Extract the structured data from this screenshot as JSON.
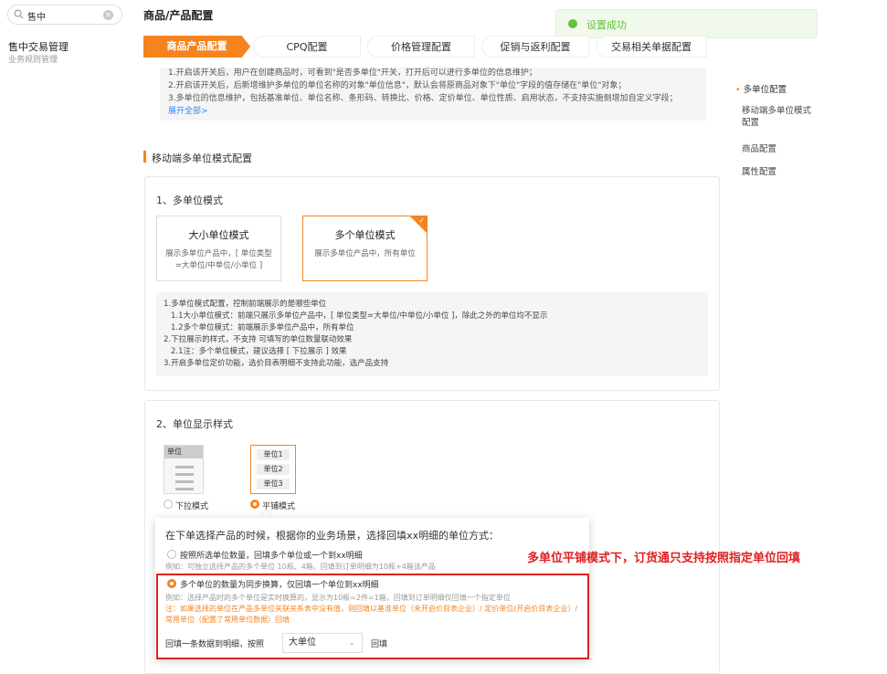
{
  "sidebar": {
    "search_value": "售中",
    "group_title": "售中交易管理",
    "group_sub": "业务规则管理"
  },
  "header": {
    "title": "商品/产品配置"
  },
  "toast": {
    "message": "设置成功",
    "color": "#67c23a"
  },
  "tabs": [
    "商品产品配置",
    "CPQ配置",
    "价格管理配置",
    "促销与返利配置",
    "交易相关单据配置"
  ],
  "info": {
    "lines": [
      "1.开启该开关后，用户在创建商品时，可看到\"是否多单位\"开关，打开后可以进行多单位的信息维护；",
      "2.开启该开关后，后新增维护多单位的单位名称的对象\"单位信息\"，默认会将原商品对象下\"单位\"字段的值存储在\"单位\"对象；",
      "3.多单位的信息维护，包括基准单位、单位名称、条形码、转换比、价格、定价单位、单位性质、启用状态，不支持实施侧增加自定义字段；"
    ],
    "expand_link": "展开全部>"
  },
  "anchors": [
    "多单位配置",
    "移动端多单位模式配置",
    "商品配置",
    "属性配置"
  ],
  "section": {
    "title": "移动端多单位模式配置"
  },
  "card1": {
    "heading": "1、多单位模式",
    "modes": [
      {
        "title": "大小单位模式",
        "desc": "展示多单位产品中，[ 单位类型=大单位/中单位/小单位 ]"
      },
      {
        "title": "多个单位模式",
        "desc": "展示多单位产品中，所有单位"
      }
    ],
    "notes": [
      "1.多单位模式配置，控制前端展示的是哪些单位",
      "1.1大小单位模式：前端只展示多单位产品中，[ 单位类型=大单位/中单位/小单位 ]，除此之外的单位均不显示",
      "1.2多个单位模式：前端展示多单位产品中，所有单位",
      "2.下拉展示的样式，不支持 可填写的单位数量联动效果",
      "2.1注：多个单位模式，建议选择 [ 下拉展示 ] 效果",
      "3.开启多单位定价功能，选价目表明细不支持此功能，选产品支持"
    ]
  },
  "card2": {
    "heading": "2、单位显示样式",
    "dropdown_icon_label": "单位",
    "tile_cells": [
      "单位1",
      "单位2",
      "单位3"
    ],
    "style_options": [
      "下拉模式",
      "平铺模式"
    ]
  },
  "popover": {
    "question": "在下单选择产品的时候，根据你的业务场景，选择回填xx明细的单位方式：",
    "option1": "按照所选单位数量，回填多个单位或一个到xx明细",
    "option1_example": "例如：可独立选择产品的多个单位 10瓶、4箱，回填到订单明细为10瓶+4箱该产品",
    "option2": "多个单位的数量为同步换算，仅回填一个单位到xx明细",
    "option2_example": "例如：选择产品时的多个单位是实时换算的，显示为10瓶=2件=1箱，回填到订单明细仅回填一个指定单位",
    "option2_warning": "注：如果选择的单位在产品多单位关联关系表中没有值，则回填以基准单位（未开启价目表企业）/ 定价单位(开启价目表企业）/ 常用单位（配置了常用单位数据）回填",
    "fill_prefix": "回填一条数据到明细，按照",
    "unit_select": "大单位",
    "fill_suffix": "回填"
  },
  "callout": "多单位平铺模式下，订货通只支持按照指定单位回填",
  "colors": {
    "accent": "#f5841f",
    "alert": "#e02020"
  }
}
